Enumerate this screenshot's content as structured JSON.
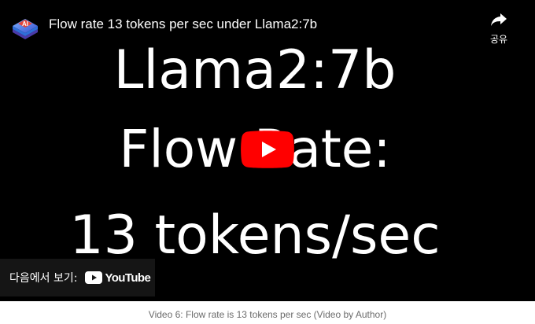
{
  "video": {
    "title": "Flow rate 13 tokens per sec under Llama2:7b",
    "channel_avatar_icon": "ai-chip-avatar-icon",
    "share_label": "공유",
    "share_icon": "share-arrow-icon",
    "play_icon": "youtube-play-icon",
    "slide_lines": [
      "Llama2:7b",
      "Flow Rate:",
      "13 tokens/sec"
    ]
  },
  "watch_on": {
    "label": "다음에서 보기:",
    "brand": "YouTube"
  },
  "caption": "Video 6: Flow rate is 13 tokens per sec (Video by Author)",
  "colors": {
    "player_bg": "#000000",
    "play_red": "#ff0000",
    "caption_gray": "#6b6b6b"
  }
}
